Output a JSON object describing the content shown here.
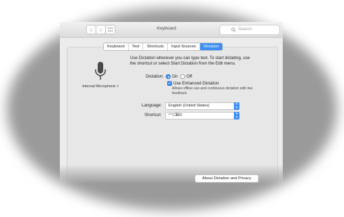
{
  "window": {
    "title": "Keyboard",
    "nav": {
      "back_icon": "chevron-left-icon",
      "forward_icon": "chevron-right-icon",
      "grid_icon": "grid-icon"
    },
    "search": {
      "placeholder": "Search",
      "icon": "search-icon"
    }
  },
  "tabs": [
    {
      "label": "Keyboard",
      "active": false
    },
    {
      "label": "Text",
      "active": false
    },
    {
      "label": "Shortcuts",
      "active": false
    },
    {
      "label": "Input Sources",
      "active": false
    },
    {
      "label": "Dictation",
      "active": true
    }
  ],
  "dictation": {
    "microphone_icon": "microphone-icon",
    "mic_source": "Internal Microphone",
    "description": "Use Dictation wherever you can type text. To start dictating, use the shortcut or select Start Dictation from the Edit menu.",
    "dictation_label": "Dictation:",
    "on_label": "On",
    "off_label": "Off",
    "selected": "On",
    "enhanced_label": "Use Enhanced Dictation",
    "enhanced_checked": true,
    "enhanced_note": "Allows offline use and continuous dictation with live feedback.",
    "language_label": "Language:",
    "language_value": "English (United States)",
    "shortcut_label": "Shortcut:",
    "shortcut_value": "^⌥⌘D",
    "about_button": "About Dictation and Privacy"
  },
  "colors": {
    "accent": "#3c8ef5",
    "window_bg": "#ececec",
    "vignette": "#9a9a9a"
  }
}
